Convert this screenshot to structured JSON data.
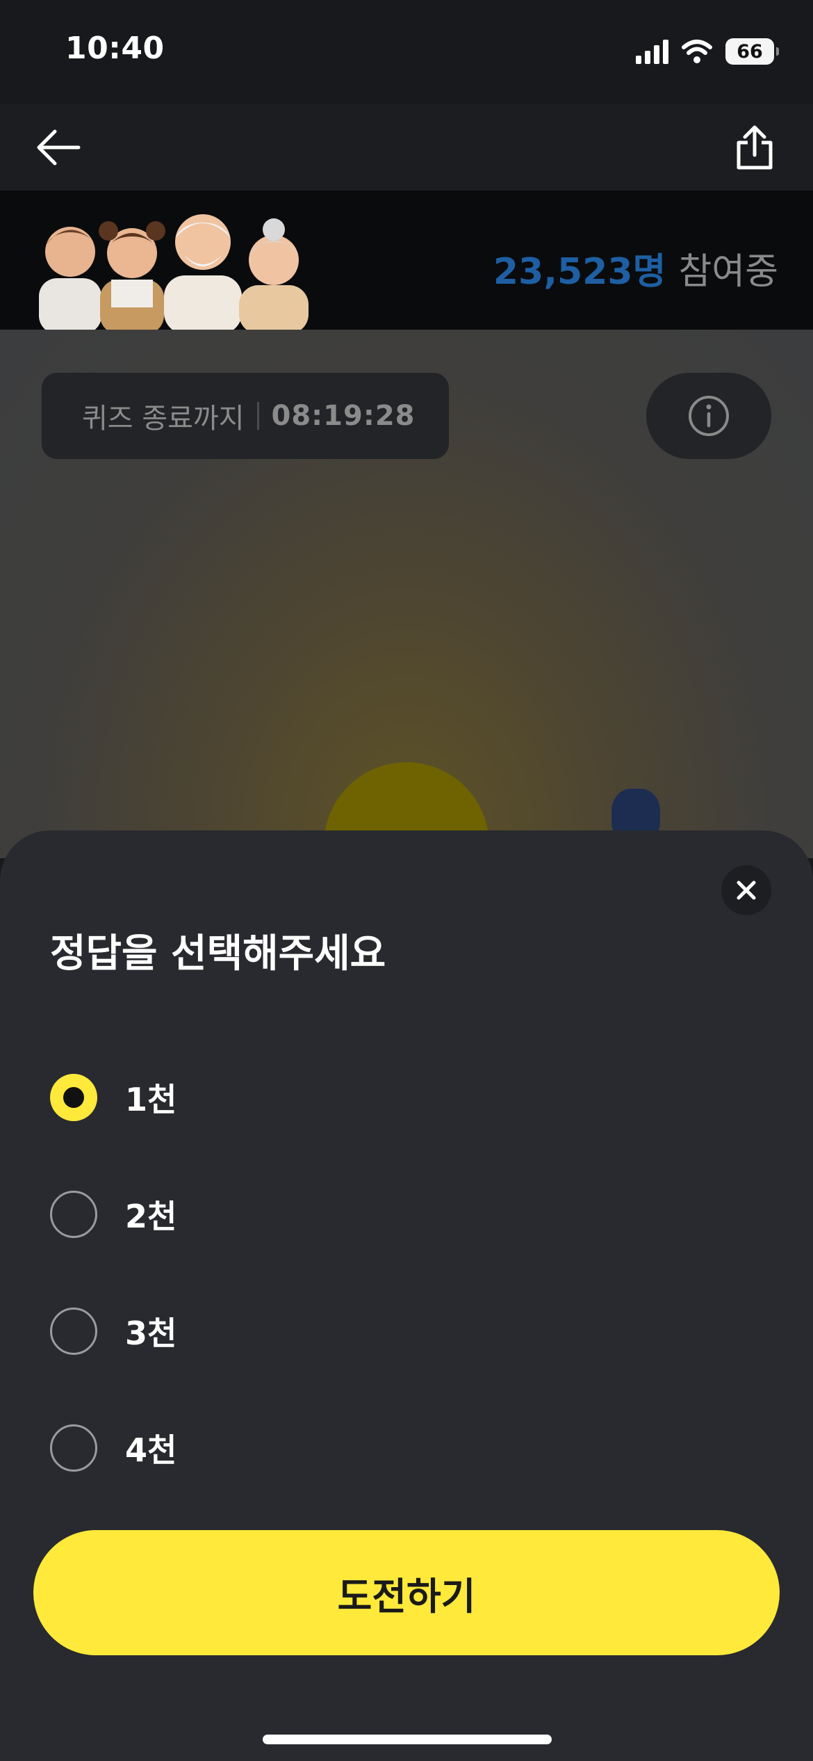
{
  "status_bar": {
    "time": "10:40",
    "battery": "66",
    "icons": [
      "signal-icon",
      "wifi-icon",
      "battery-icon"
    ]
  },
  "nav": {
    "back_icon": "arrow-left-icon",
    "share_icon": "share-icon"
  },
  "banner": {
    "participant_count": "23,523명",
    "participant_suffix": "참여중",
    "count_color": "#1e5fa3"
  },
  "quiz": {
    "timer_label": "퀴즈 종료까지",
    "timer_value": "08:19:28",
    "info_icon": "info-icon"
  },
  "sheet": {
    "title": "정답을 선택해주세요",
    "close_icon": "close-icon",
    "options": [
      {
        "label": "1천",
        "selected": true
      },
      {
        "label": "2천",
        "selected": false
      },
      {
        "label": "3천",
        "selected": false
      },
      {
        "label": "4천",
        "selected": false
      }
    ],
    "submit_label": "도전하기"
  },
  "colors": {
    "accent": "#ffe93b",
    "sheet_background": "#282a2f",
    "background": "#17191c"
  }
}
